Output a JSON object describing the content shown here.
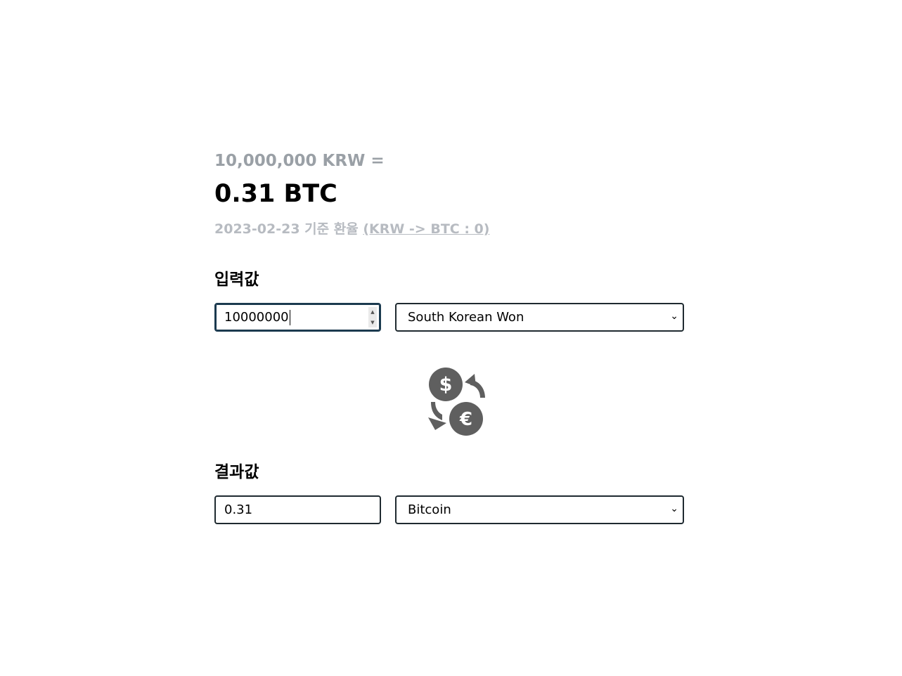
{
  "summary": {
    "from_amount": "10,000,000 KRW =",
    "to_amount": "0.31 BTC",
    "rate_date": "2023-02-23 기준 환율",
    "rate_link": "(KRW -> BTC : 0)"
  },
  "input_section": {
    "label": "입력값",
    "amount_value": "10000000",
    "currency_selected": "South Korean Won"
  },
  "swap": {
    "icon": "currency-exchange-icon"
  },
  "result_section": {
    "label": "결과값",
    "amount_value": "0.31",
    "currency_selected": "Bitcoin"
  },
  "colors": {
    "muted_text": "#9aa0a6",
    "faint_text": "#b7bbc1",
    "icon_gray": "#5f5f5f",
    "field_border": "#1f2a30"
  }
}
